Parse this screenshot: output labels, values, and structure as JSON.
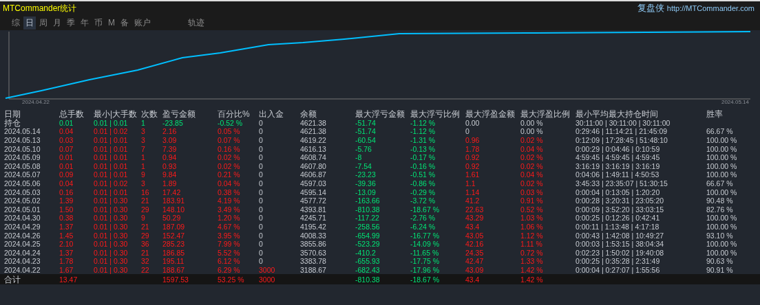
{
  "window": {
    "title": "MTCommander统计",
    "brand": "复盘侠",
    "url": "http://MTCommander.com"
  },
  "tabs": [
    {
      "label": "综",
      "selected": false
    },
    {
      "label": "日",
      "selected": true
    },
    {
      "label": "周",
      "selected": false
    },
    {
      "label": "月",
      "selected": false
    },
    {
      "label": "季",
      "selected": false
    },
    {
      "label": "年",
      "selected": false
    },
    {
      "label": "币",
      "selected": false
    },
    {
      "label": "M",
      "selected": false
    },
    {
      "label": "备",
      "selected": false
    },
    {
      "label": "账户",
      "selected": false
    },
    {
      "label": "轨迹",
      "selected": false
    }
  ],
  "chart": {
    "start_label": "2024.04.22",
    "end_label": "2024.05.14"
  },
  "table": {
    "columns": [
      "日期",
      "总手数",
      "最小|大手数",
      "次数",
      "盈亏金额",
      "百分比%",
      "出入金",
      "余额",
      "最大浮亏金额",
      "最大浮亏比例",
      "最大浮盈金额",
      "最大浮盈比例",
      "最小平均最大持仓时间",
      "胜率"
    ],
    "rows": [
      {
        "kind": "open",
        "peak_gain": false,
        "deposit_in": false,
        "cells": [
          "持仓",
          "0.01",
          "0.01 | 0.01",
          "1",
          "-23.85",
          "-0.52 %",
          "0",
          "4621.38",
          "-51.74",
          "-1.12 %",
          "0.00",
          "0.00 %",
          "30:11:00 | 30:11:00 | 30:11:00",
          ""
        ]
      },
      {
        "kind": "day",
        "peak_gain": false,
        "deposit_in": false,
        "cells": [
          "2024.05.14",
          "0.04",
          "0.01 | 0.02",
          "3",
          "2.16",
          "0.05 %",
          "0",
          "4621.38",
          "-51.74",
          "-1.12 %",
          "0",
          "0.00 %",
          "0:29:46 | 11:14:21 | 21:45:09",
          "66.67 %"
        ]
      },
      {
        "kind": "day",
        "peak_gain": true,
        "deposit_in": false,
        "cells": [
          "2024.05.13",
          "0.03",
          "0.01 | 0.01",
          "3",
          "3.09",
          "0.07 %",
          "0",
          "4619.22",
          "-60.54",
          "-1.31 %",
          "0.96",
          "0.02 %",
          "0:12:09 | 17:28:45 | 51:48:10",
          "100.00 %"
        ]
      },
      {
        "kind": "day",
        "peak_gain": true,
        "deposit_in": false,
        "cells": [
          "2024.05.10",
          "0.07",
          "0.01 | 0.01",
          "7",
          "7.39",
          "0.16 %",
          "0",
          "4616.13",
          "-5.76",
          "-0.13 %",
          "1.78",
          "0.04 %",
          "0:00:29 | 0:04:46 | 0:10:59",
          "100.00 %"
        ]
      },
      {
        "kind": "day",
        "peak_gain": true,
        "deposit_in": false,
        "cells": [
          "2024.05.09",
          "0.01",
          "0.01 | 0.01",
          "1",
          "0.94",
          "0.02 %",
          "0",
          "4608.74",
          "-8",
          "-0.17 %",
          "0.92",
          "0.02 %",
          "4:59:45 | 4:59:45 | 4:59:45",
          "100.00 %"
        ]
      },
      {
        "kind": "day",
        "peak_gain": true,
        "deposit_in": false,
        "cells": [
          "2024.05.08",
          "0.01",
          "0.01 | 0.01",
          "1",
          "0.93",
          "0.02 %",
          "0",
          "4607.80",
          "-7.54",
          "-0.16 %",
          "0.92",
          "0.02 %",
          "3:16:19 | 3:16:19 | 3:16:19",
          "100.00 %"
        ]
      },
      {
        "kind": "day",
        "peak_gain": true,
        "deposit_in": false,
        "cells": [
          "2024.05.07",
          "0.09",
          "0.01 | 0.01",
          "9",
          "9.84",
          "0.21 %",
          "0",
          "4606.87",
          "-23.23",
          "-0.51 %",
          "1.61",
          "0.04 %",
          "0:04:06 | 1:49:11 | 4:50:53",
          "100.00 %"
        ]
      },
      {
        "kind": "day",
        "peak_gain": true,
        "deposit_in": false,
        "cells": [
          "2024.05.06",
          "0.04",
          "0.01 | 0.02",
          "3",
          "1.89",
          "0.04 %",
          "0",
          "4597.03",
          "-39.36",
          "-0.86 %",
          "1.1",
          "0.02 %",
          "3:45:33 | 23:35:07 | 51:30:15",
          "66.67 %"
        ]
      },
      {
        "kind": "day",
        "peak_gain": true,
        "deposit_in": false,
        "cells": [
          "2024.05.03",
          "0.16",
          "0.01 | 0.01",
          "16",
          "17.42",
          "0.38 %",
          "0",
          "4595.14",
          "-13.09",
          "-0.29 %",
          "1.14",
          "0.03 %",
          "0:00:04 | 0:13:05 | 1:20:20",
          "100.00 %"
        ]
      },
      {
        "kind": "day",
        "peak_gain": true,
        "deposit_in": false,
        "cells": [
          "2024.05.02",
          "1.39",
          "0.01 | 0.30",
          "21",
          "183.91",
          "4.19 %",
          "0",
          "4577.72",
          "-163.66",
          "-3.72 %",
          "41.2",
          "0.91 %",
          "0:00:28 | 3:20:31 | 23:05:20",
          "90.48 %"
        ]
      },
      {
        "kind": "day",
        "peak_gain": true,
        "deposit_in": false,
        "cells": [
          "2024.05.01",
          "1.50",
          "0.01 | 0.30",
          "29",
          "148.10",
          "3.49 %",
          "0",
          "4393.81",
          "-810.38",
          "-18.67 %",
          "22.63",
          "0.52 %",
          "0:00:09 | 3:52:20 | 33:03:15",
          "82.76 %"
        ]
      },
      {
        "kind": "day",
        "peak_gain": true,
        "deposit_in": false,
        "cells": [
          "2024.04.30",
          "0.38",
          "0.01 | 0.30",
          "9",
          "50.29",
          "1.20 %",
          "0",
          "4245.71",
          "-117.22",
          "-2.76 %",
          "43.29",
          "1.03 %",
          "0:00:25 | 0:12:26 | 0:42:41",
          "100.00 %"
        ]
      },
      {
        "kind": "day",
        "peak_gain": true,
        "deposit_in": false,
        "cells": [
          "2024.04.29",
          "1.37",
          "0.01 | 0.30",
          "21",
          "187.09",
          "4.67 %",
          "0",
          "4195.42",
          "-258.56",
          "-6.24 %",
          "43.4",
          "1.06 %",
          "0:00:11 | 1:13:48 | 4:17:18",
          "100.00 %"
        ]
      },
      {
        "kind": "day",
        "peak_gain": true,
        "deposit_in": false,
        "cells": [
          "2024.04.26",
          "1.45",
          "0.01 | 0.30",
          "29",
          "152.47",
          "3.95 %",
          "0",
          "4008.33",
          "-654.99",
          "-16.77 %",
          "43.05",
          "1.12 %",
          "0:00:43 | 1:42:08 | 10:49:27",
          "93.10 %"
        ]
      },
      {
        "kind": "day",
        "peak_gain": true,
        "deposit_in": false,
        "cells": [
          "2024.04.25",
          "2.10",
          "0.01 | 0.30",
          "36",
          "285.23",
          "7.99 %",
          "0",
          "3855.86",
          "-523.29",
          "-14.09 %",
          "42.16",
          "1.11 %",
          "0:00:03 | 1:53:15 | 38:04:34",
          "100.00 %"
        ]
      },
      {
        "kind": "day",
        "peak_gain": true,
        "deposit_in": false,
        "cells": [
          "2024.04.24",
          "1.37",
          "0.01 | 0.30",
          "21",
          "186.85",
          "5.52 %",
          "0",
          "3570.63",
          "-410.2",
          "-11.65 %",
          "24.35",
          "0.72 %",
          "0:02:23 | 1:50:02 | 19:40:08",
          "100.00 %"
        ]
      },
      {
        "kind": "day",
        "peak_gain": true,
        "deposit_in": false,
        "cells": [
          "2024.04.23",
          "1.78",
          "0.01 | 0.30",
          "32",
          "195.11",
          "6.12 %",
          "0",
          "3383.78",
          "-655.93",
          "-17.75 %",
          "42.47",
          "1.33 %",
          "0:00:25 | 0:35:28 | 2:31:49",
          "90.63 %"
        ]
      },
      {
        "kind": "day",
        "peak_gain": true,
        "deposit_in": true,
        "cells": [
          "2024.04.22",
          "1.67",
          "0.01 | 0.30",
          "22",
          "188.67",
          "6.29 %",
          "3000",
          "3188.67",
          "-682.43",
          "-17.96 %",
          "43.09",
          "1.42 %",
          "0:00:04 | 0:27:07 | 1:55:56",
          "90.91 %"
        ]
      }
    ],
    "total": {
      "kind": "total",
      "peak_gain": true,
      "deposit_in": true,
      "cells": [
        "合计",
        "13.47",
        "",
        "",
        "1597.53",
        "53.25 %",
        "3000",
        "",
        "-810.38",
        "-18.67 %",
        "43.4",
        "1.42 %",
        "",
        ""
      ]
    }
  }
}
